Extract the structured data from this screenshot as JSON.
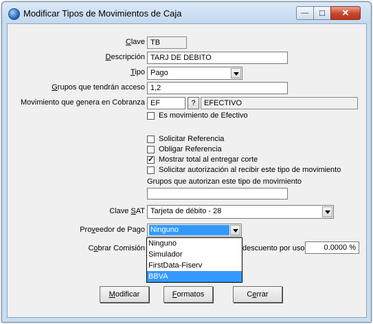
{
  "window": {
    "title": "Modificar Tipos de Movimientos de Caja",
    "minimize": "—",
    "maximize": "☐",
    "close": "✕"
  },
  "form": {
    "clave_label": "Clave",
    "clave_value": "TB",
    "descripcion_label": "Descripción",
    "descripcion_value": "TARJ DE DEBITO",
    "tipo_label": "Tipo",
    "tipo_value": "Pago",
    "grupos_label": "Grupos que tendrán acceso",
    "grupos_value": "1,2",
    "movimiento_label": "Movimiento que genera en Cobranza",
    "movimiento_code": "EF",
    "movimiento_lookup": "?",
    "movimiento_name": "EFECTIVO",
    "es_efectivo_label": "Es movimiento de Efectivo",
    "es_efectivo_checked": false,
    "solicitar_ref_label": "Solicitar Referencia",
    "solicitar_ref_checked": false,
    "obligar_ref_label": "Obligar Referencia",
    "obligar_ref_checked": false,
    "mostrar_total_label": "Mostrar total al entregar corte",
    "mostrar_total_checked": true,
    "solicitar_aut_label": "Solicitar autorización al recibir este tipo de movimiento",
    "solicitar_aut_checked": false,
    "grupos_autorizan_label": "Grupos que autorizan este tipo de movimiento",
    "grupos_autorizan_value": "",
    "clave_sat_label": "Clave SAT",
    "clave_sat_value": "Tarjeta de débito - 28",
    "proveedor_label": "Proveedor de Pago",
    "proveedor_value": "Ninguno",
    "proveedor_options": [
      "Ninguno",
      "Simulador",
      "FirstData-Fiserv",
      "BBVA"
    ],
    "proveedor_highlighted": "BBVA",
    "cobrar_comision_label": "Cobrar Comisión",
    "descuento_label": "descuento por uso",
    "descuento_value": "0.0000 %"
  },
  "buttons": {
    "modificar": "Modificar",
    "formatos": "Formatos",
    "cerrar": "Cerrar"
  }
}
